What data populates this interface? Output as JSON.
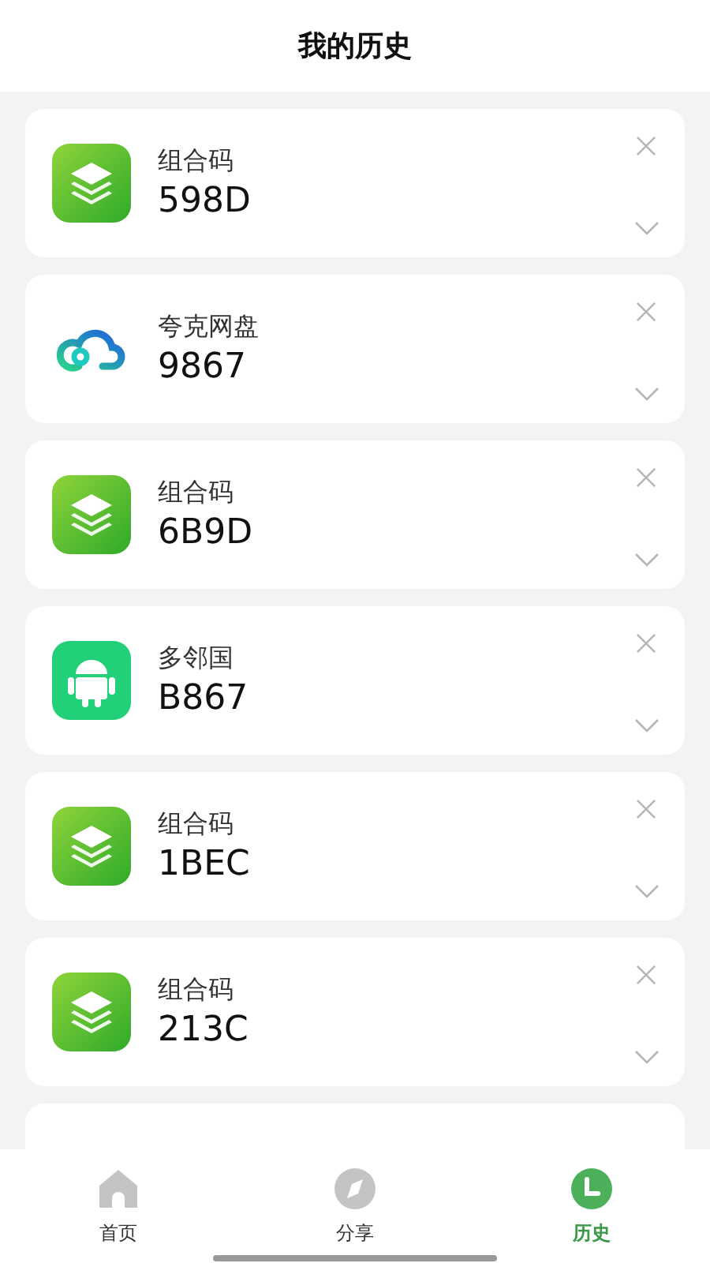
{
  "header": {
    "title": "我的历史"
  },
  "history": [
    {
      "app": "组合码",
      "code": "598D",
      "kind": "layers"
    },
    {
      "app": "夸克网盘",
      "code": "9867",
      "kind": "cloud"
    },
    {
      "app": "组合码",
      "code": "6B9D",
      "kind": "layers"
    },
    {
      "app": "多邻国",
      "code": "B867",
      "kind": "android"
    },
    {
      "app": "组合码",
      "code": "1BEC",
      "kind": "layers"
    },
    {
      "app": "组合码",
      "code": "213C",
      "kind": "layers"
    },
    {
      "kind": "partial"
    }
  ],
  "tabbar": [
    {
      "label": "首页",
      "kind": "home",
      "selected": false
    },
    {
      "label": "分享",
      "kind": "compass",
      "selected": false
    },
    {
      "label": "历史",
      "kind": "clock",
      "selected": true
    }
  ]
}
